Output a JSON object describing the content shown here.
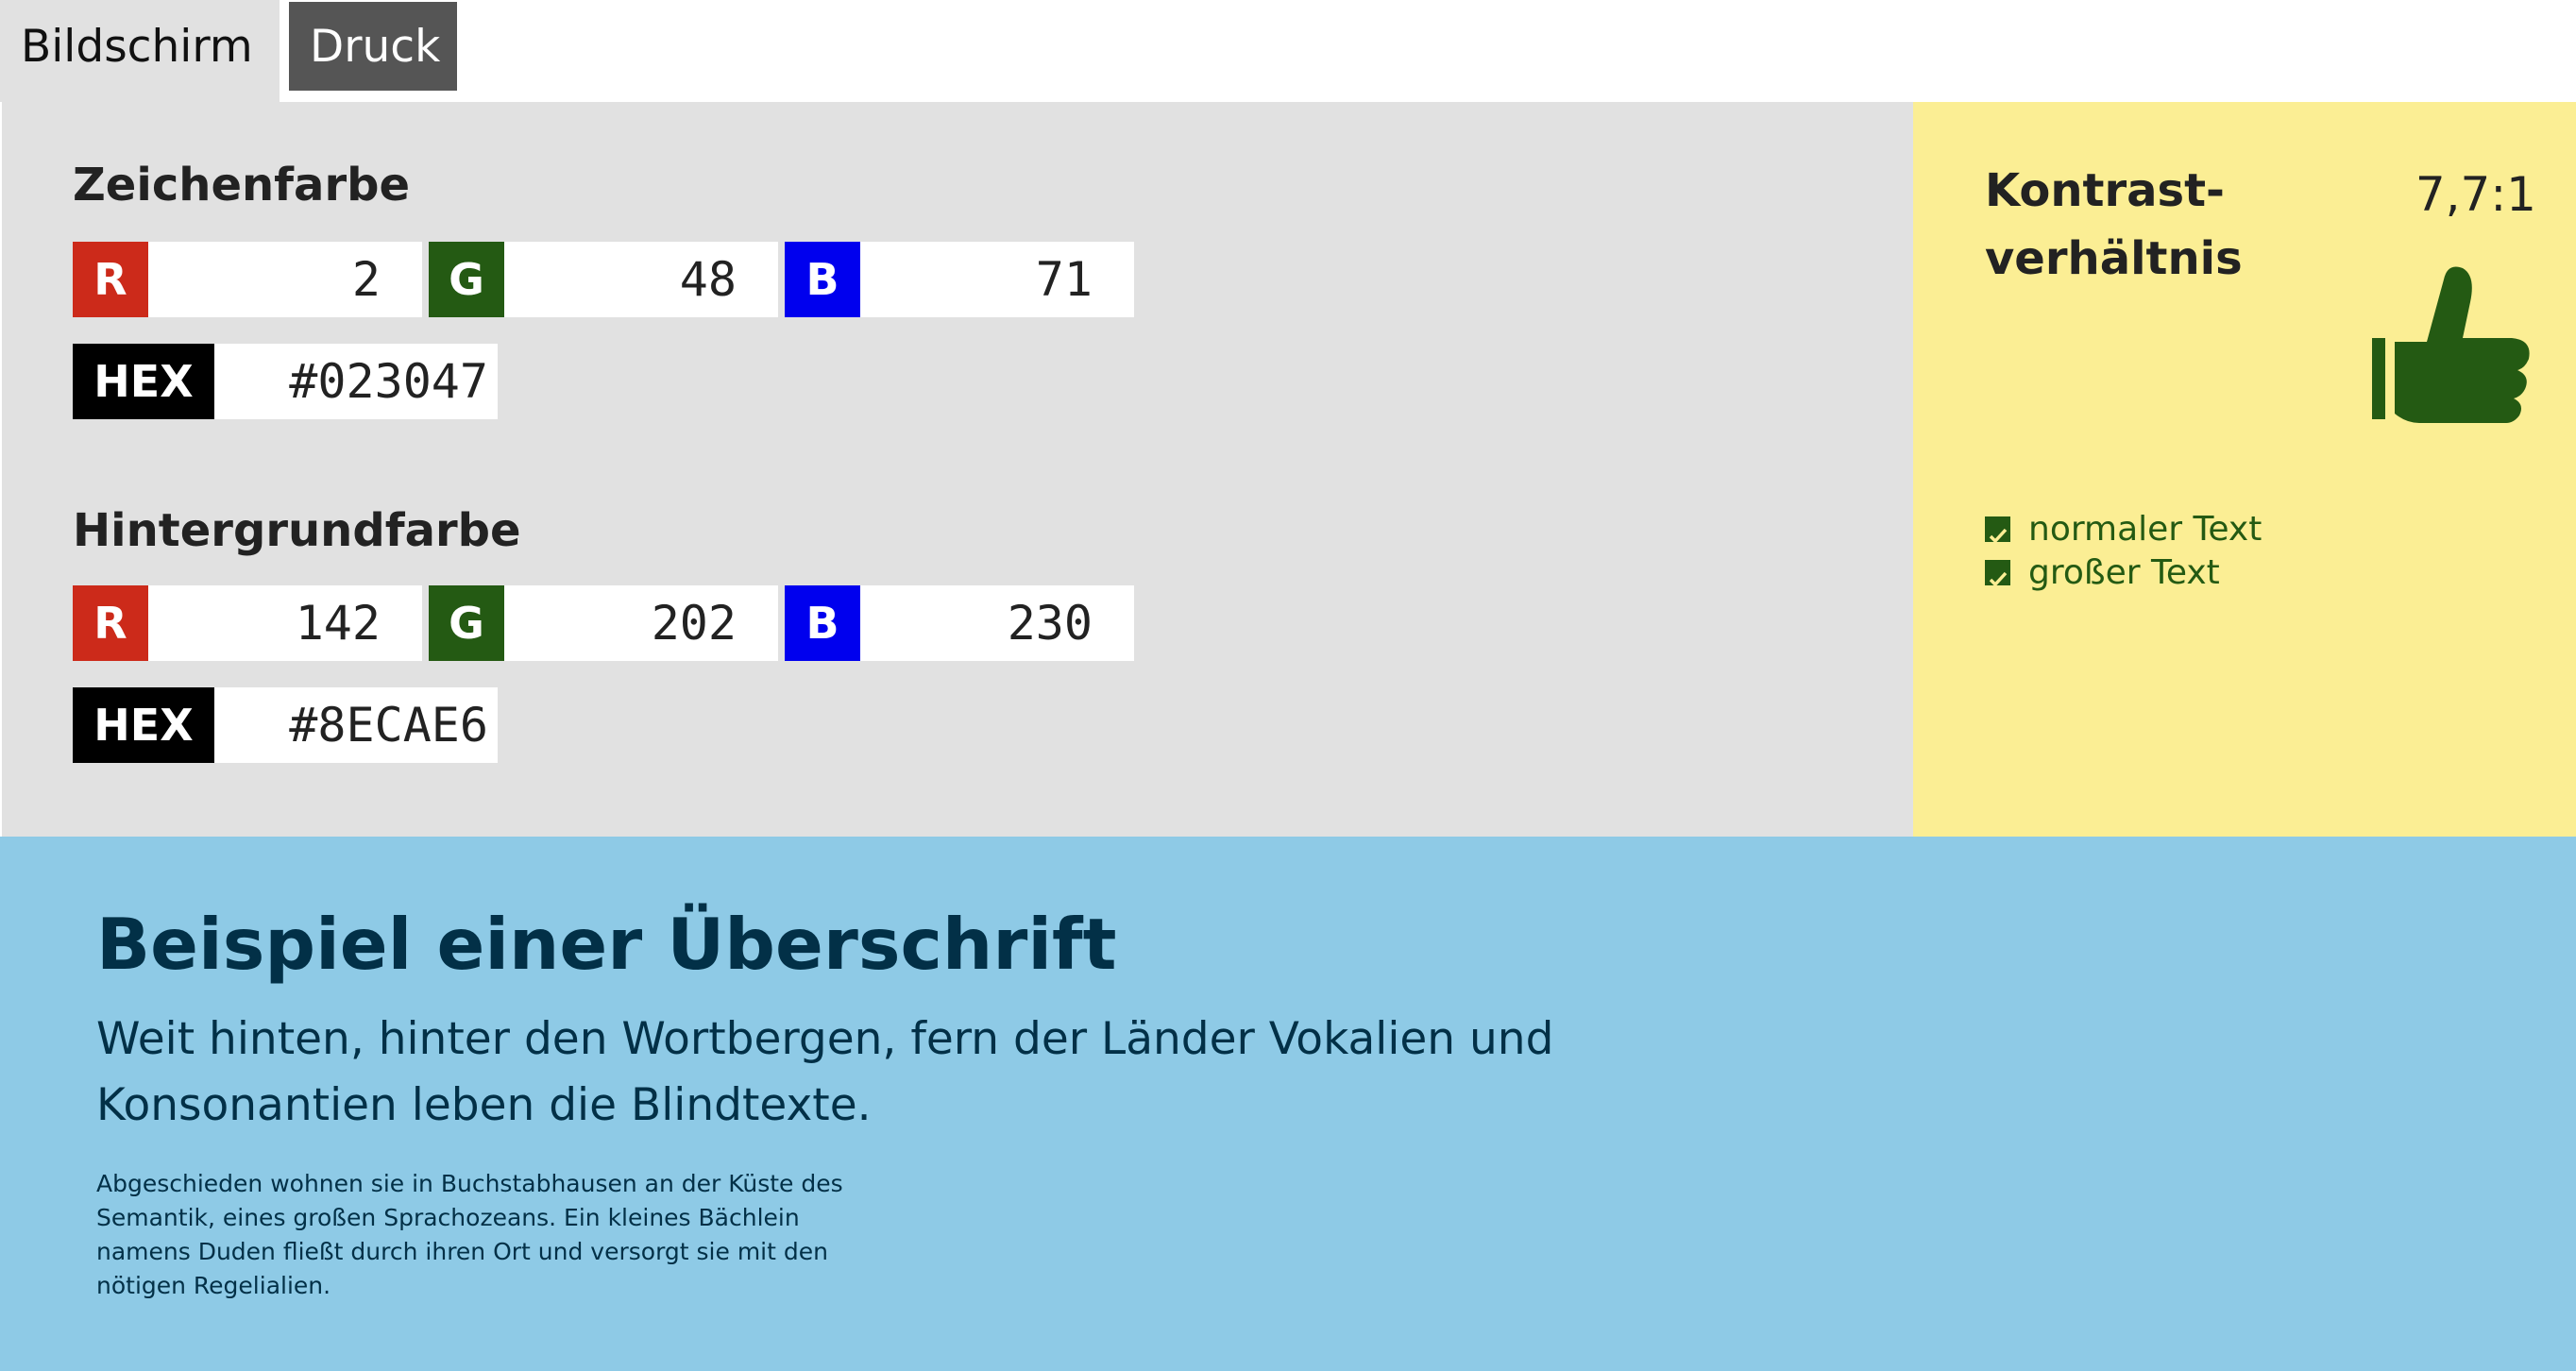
{
  "tabs": [
    {
      "label": "Bildschirm",
      "active": true
    },
    {
      "label": "Druck",
      "active": false
    }
  ],
  "foreground": {
    "title": "Zeichenfarbe",
    "channels": [
      {
        "label": "R",
        "value": "2",
        "color": "#cc2a1a"
      },
      {
        "label": "G",
        "value": "48",
        "color": "#245a13"
      },
      {
        "label": "B",
        "value": "71",
        "color": "#0000ee"
      }
    ],
    "hex_label": "HEX",
    "hex_value": "#023047"
  },
  "background": {
    "title": "Hintergrundfarbe",
    "channels": [
      {
        "label": "R",
        "value": "142",
        "color": "#cc2a1a"
      },
      {
        "label": "G",
        "value": "202",
        "color": "#245a13"
      },
      {
        "label": "B",
        "value": "230",
        "color": "#0000ee"
      }
    ],
    "hex_label": "HEX",
    "hex_value": "#8ECAE6"
  },
  "contrast": {
    "title_line1": "Kontrast-",
    "title_line2": "verhältnis",
    "ratio": "7,7:1",
    "icon": "thumbs-up-icon",
    "checks": [
      {
        "label": "normaler Text",
        "passed": true
      },
      {
        "label": "großer Text",
        "passed": true
      }
    ],
    "panel_color": "#fbee94",
    "pass_color": "#245a13"
  },
  "preview": {
    "heading": "Beispiel einer Überschrift",
    "lead": "Weit hinten, hinter den Wortbergen, fern der Länder Vokalien und Konsonantien leben die Blindtexte.",
    "small": "Abgeschieden wohnen sie in Buchstabhausen an der Küste des Semantik, eines großen Sprachozeans. Ein kleines Bächlein namens Duden fließt durch ihren Ort und versorgt sie mit den nötigen Regelialien.",
    "text_color": "#023047",
    "background_color": "#8ecae6"
  }
}
